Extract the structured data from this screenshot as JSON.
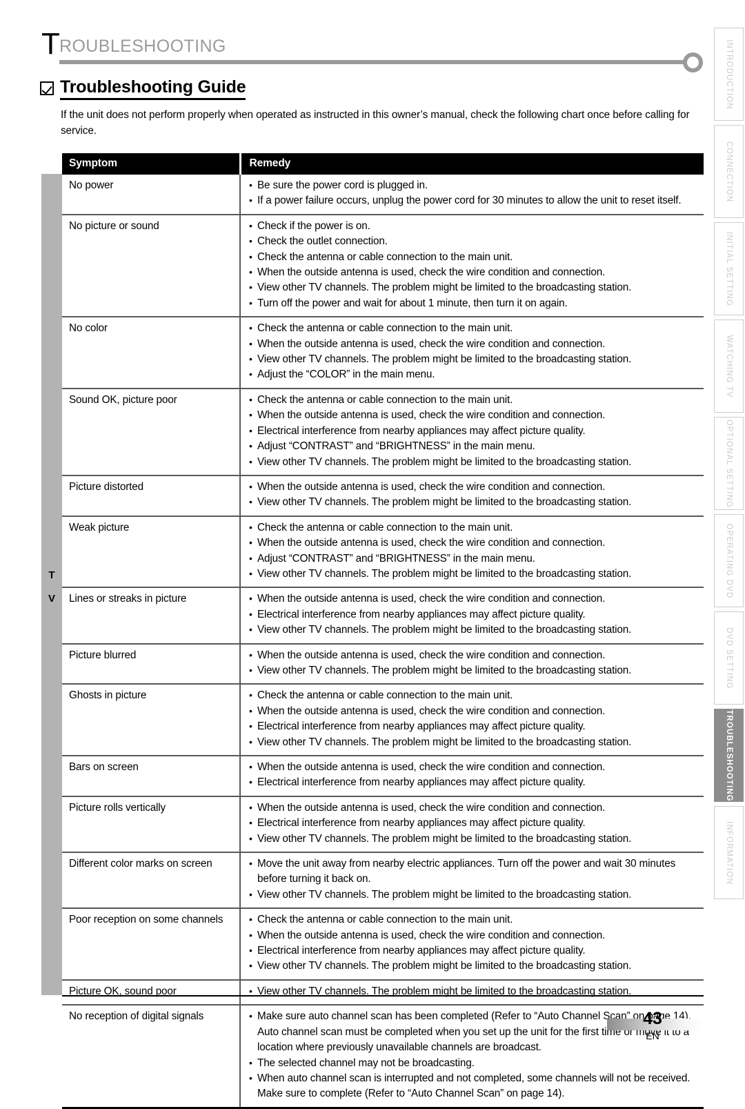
{
  "chapter": {
    "dropcap": "T",
    "rest": "ROUBLESHOOTING"
  },
  "section": {
    "title": "Troubleshooting Guide",
    "intro": "If the unit does not perform properly when operated as instructed in this owner’s manual, check the following chart once before calling for service."
  },
  "side_strip": {
    "line1": "T",
    "line2": "V"
  },
  "table": {
    "headers": [
      "Symptom",
      "Remedy"
    ],
    "rows": [
      {
        "symptom": "No power",
        "remedies": [
          {
            "bullet": true,
            "text": "Be sure the power cord is plugged in."
          },
          {
            "bullet": true,
            "text": "If a power failure occurs, unplug the power cord for 30 minutes to allow the unit to reset itself."
          }
        ]
      },
      {
        "symptom": "No picture or sound",
        "remedies": [
          {
            "bullet": true,
            "text": "Check if the power is on."
          },
          {
            "bullet": true,
            "text": "Check the outlet connection."
          },
          {
            "bullet": true,
            "text": "Check the antenna or cable connection to the main unit."
          },
          {
            "bullet": true,
            "text": "When the outside antenna is used, check the wire condition and connection."
          },
          {
            "bullet": true,
            "text": "View other TV channels. The problem might be limited to the broadcasting station."
          },
          {
            "bullet": true,
            "text": "Turn off the power and wait for about 1 minute, then turn it on again."
          }
        ]
      },
      {
        "symptom": "No color",
        "remedies": [
          {
            "bullet": true,
            "text": "Check the antenna or cable connection to the main unit."
          },
          {
            "bullet": true,
            "text": "When the outside antenna is used, check the wire condition and connection."
          },
          {
            "bullet": true,
            "text": "View other TV channels. The problem might be limited to the broadcasting station."
          },
          {
            "bullet": true,
            "text": "Adjust the “COLOR” in the main menu."
          }
        ]
      },
      {
        "symptom": "Sound OK, picture poor",
        "remedies": [
          {
            "bullet": true,
            "text": "Check the antenna or cable connection to the main unit."
          },
          {
            "bullet": true,
            "text": "When the outside antenna is used, check the wire condition and connection."
          },
          {
            "bullet": true,
            "text": "Electrical interference from nearby appliances may affect picture quality."
          },
          {
            "bullet": true,
            "text": "Adjust “CONTRAST” and “BRIGHTNESS” in the main menu."
          },
          {
            "bullet": true,
            "text": "View other TV channels. The problem might be limited to the broadcasting station."
          }
        ]
      },
      {
        "symptom": "Picture distorted",
        "remedies": [
          {
            "bullet": true,
            "text": "When the outside antenna is used, check the wire condition and connection."
          },
          {
            "bullet": true,
            "text": "View other TV channels.  The problem might be limited to the broadcasting station."
          }
        ]
      },
      {
        "symptom": "Weak picture",
        "remedies": [
          {
            "bullet": true,
            "text": "Check the antenna or cable connection to the main unit."
          },
          {
            "bullet": true,
            "text": "When the outside antenna is used, check the wire condition and connection."
          },
          {
            "bullet": true,
            "text": "Adjust “CONTRAST” and “BRIGHTNESS” in the main menu."
          },
          {
            "bullet": true,
            "text": "View other TV channels. The problem might be limited to the broadcasting station."
          }
        ]
      },
      {
        "symptom": "Lines or streaks in picture",
        "remedies": [
          {
            "bullet": true,
            "text": "When the outside antenna is used, check the wire condition and connection."
          },
          {
            "bullet": true,
            "text": "Electrical interference from nearby appliances may affect picture quality."
          },
          {
            "bullet": true,
            "text": "View other TV channels. The problem might be limited to the broadcasting station."
          }
        ]
      },
      {
        "symptom": "Picture blurred",
        "remedies": [
          {
            "bullet": true,
            "text": "When the outside antenna is used, check the wire condition and connection."
          },
          {
            "bullet": true,
            "text": "View other TV channels. The problem might be limited to the broadcasting station."
          }
        ]
      },
      {
        "symptom": "Ghosts in picture",
        "remedies": [
          {
            "bullet": true,
            "text": "Check the antenna or cable connection to the main unit."
          },
          {
            "bullet": true,
            "text": "When the outside antenna is used, check the wire condition and connection."
          },
          {
            "bullet": true,
            "text": "Electrical interference from nearby appliances may affect picture quality."
          },
          {
            "bullet": true,
            "text": "View other TV channels. The problem might be limited to the broadcasting station."
          }
        ]
      },
      {
        "symptom": "Bars on screen",
        "remedies": [
          {
            "bullet": true,
            "text": "When the outside antenna is used, check the wire condition and connection."
          },
          {
            "bullet": true,
            "text": "Electrical interference from nearby appliances may affect picture quality."
          }
        ]
      },
      {
        "symptom": "Picture rolls vertically",
        "remedies": [
          {
            "bullet": true,
            "text": "When the outside antenna is used, check the wire condition and connection."
          },
          {
            "bullet": true,
            "text": "Electrical interference from nearby appliances may affect picture quality."
          },
          {
            "bullet": true,
            "text": "View other TV channels. The problem might be limited to the broadcasting station."
          }
        ]
      },
      {
        "symptom": "Different color marks on screen",
        "remedies": [
          {
            "bullet": true,
            "text": "Move the unit away from nearby electric appliances.  Turn off the power and wait 30 minutes before turning it back on."
          },
          {
            "bullet": true,
            "text": "View other TV channels. The problem might be limited to the broadcasting station."
          }
        ]
      },
      {
        "symptom": "Poor reception on some channels",
        "remedies": [
          {
            "bullet": true,
            "text": "Check the antenna or cable connection to the main unit."
          },
          {
            "bullet": true,
            "text": "When the outside antenna is used, check the wire condition and connection."
          },
          {
            "bullet": true,
            "text": "Electrical interference from nearby appliances may affect picture quality."
          },
          {
            "bullet": true,
            "text": "View other TV channels.  The problem might be limited to the broadcasting station."
          }
        ]
      },
      {
        "symptom": "Picture OK, sound poor",
        "remedies": [
          {
            "bullet": true,
            "text": "View other TV channels. The problem might be limited to the broadcasting station."
          }
        ]
      },
      {
        "symptom": "No reception of digital signals",
        "remedies": [
          {
            "bullet": true,
            "text": "Make sure auto channel scan has been completed (Refer to “Auto Channel Scan” on page 14)."
          },
          {
            "bullet": false,
            "text": "Auto channel scan must be completed when you set up the unit for the first time or move it to a location where previously unavailable channels are broadcast."
          },
          {
            "bullet": true,
            "text": "The selected channel may not be broadcasting."
          },
          {
            "bullet": true,
            "text": "When auto channel scan is interrupted and not completed, some channels will not be received. Make sure to complete (Refer to “Auto Channel Scan” on page 14)."
          }
        ]
      }
    ]
  },
  "side_tabs": [
    {
      "label": "INTRODUCTION",
      "active": false
    },
    {
      "label": "CONNECTION",
      "active": false
    },
    {
      "label": "INITIAL  SETTING",
      "active": false
    },
    {
      "label": "WATCHING TV",
      "active": false
    },
    {
      "label": "OPTIONAL  SETTING",
      "active": false
    },
    {
      "label": "OPERATING  DVD",
      "active": false
    },
    {
      "label": "DVD  SETTING",
      "active": false
    },
    {
      "label": "TROUBLESHOOTING",
      "active": true
    },
    {
      "label": "INFORMATION",
      "active": false
    }
  ],
  "footer": {
    "page": "43",
    "language": "EN"
  },
  "colors": {
    "header_bg": "#000000",
    "rule_gray": "#9a9a9a",
    "strip_gray": "#b3b3b3",
    "tab_active": "#8c8c8c",
    "tab_text": "#c9c9c9",
    "cell_border": "#58585a"
  }
}
